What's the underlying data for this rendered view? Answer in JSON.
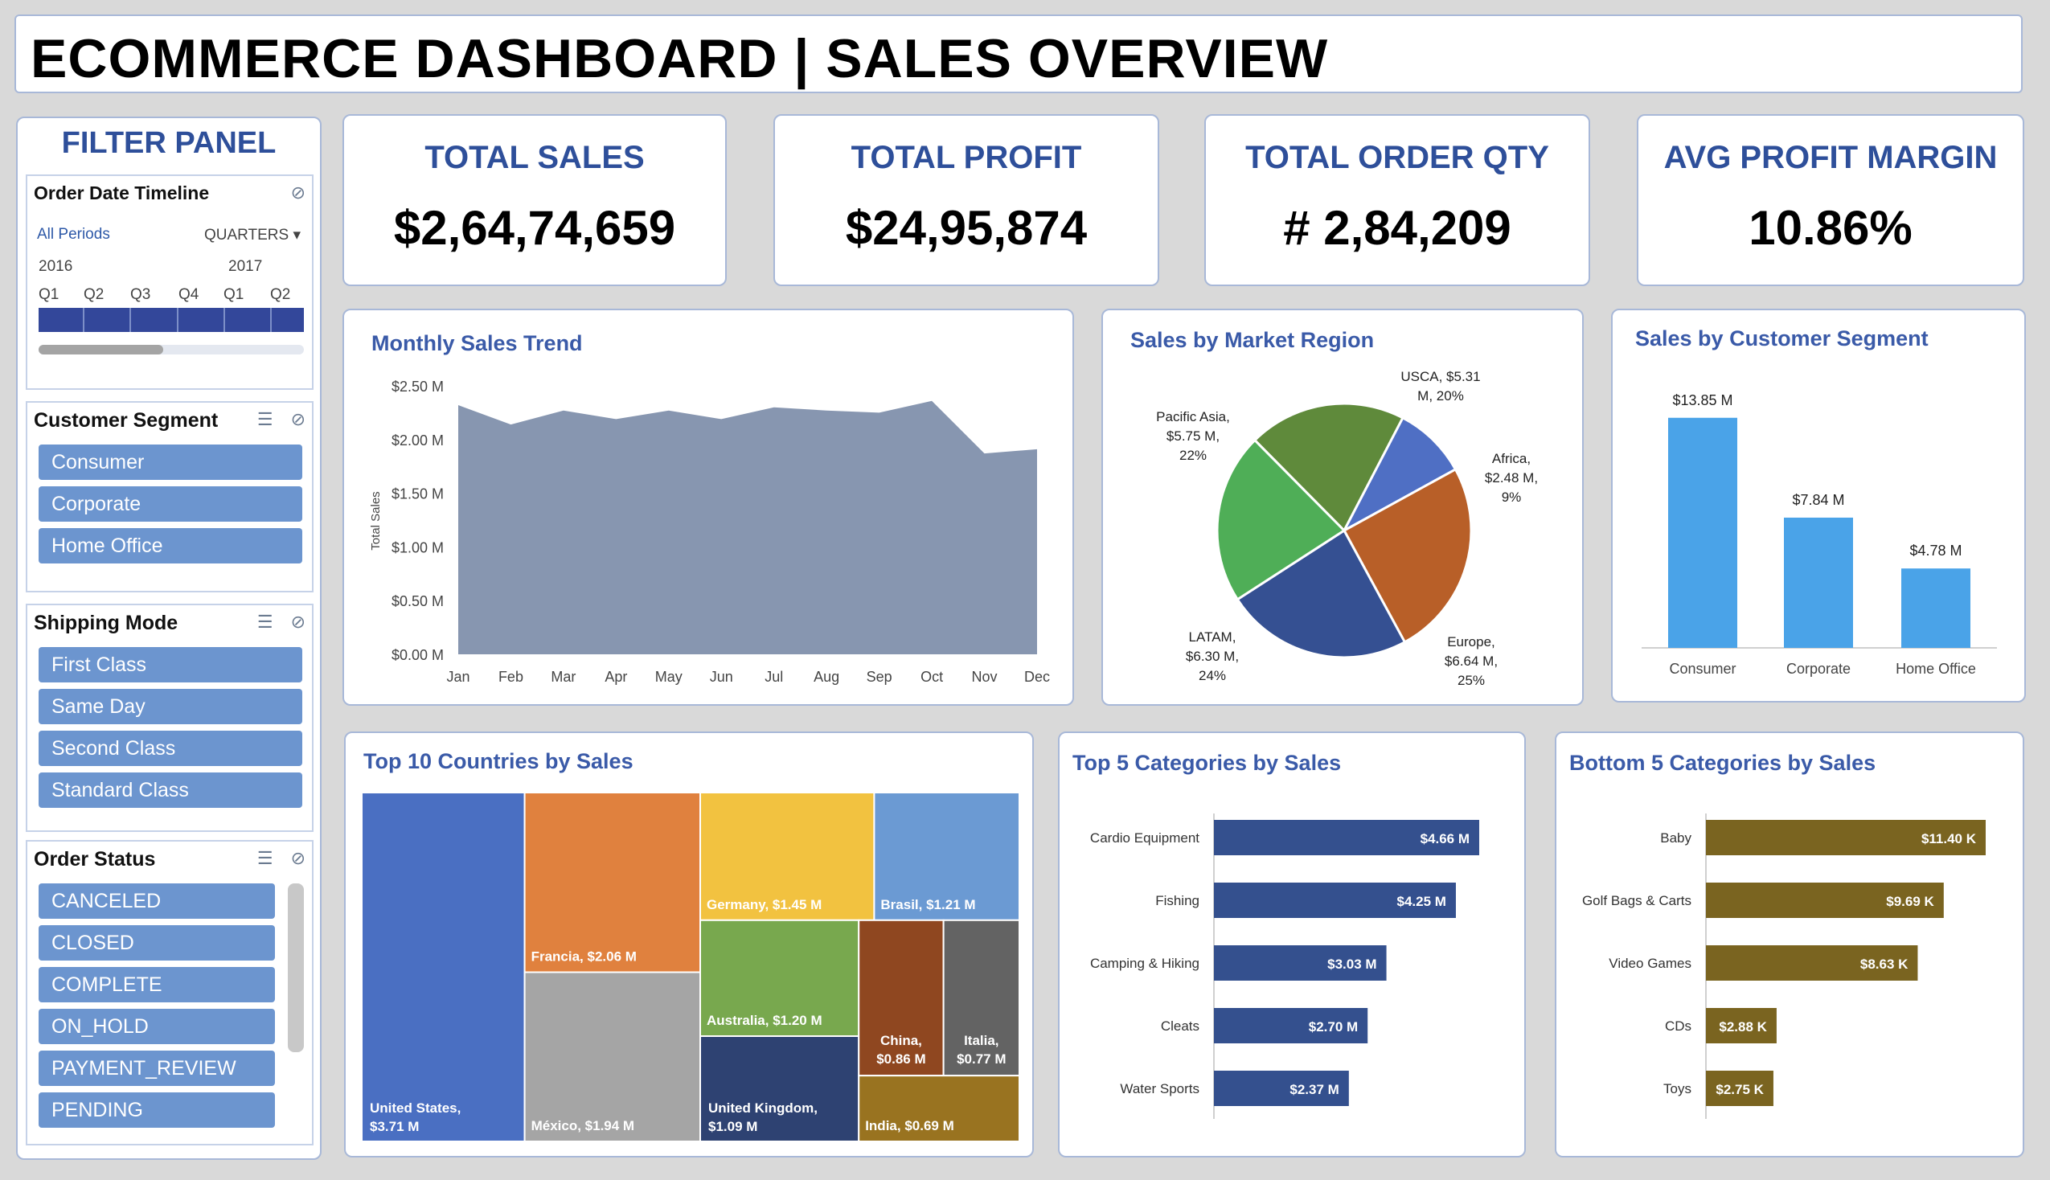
{
  "header": {
    "title": "ECOMMERCE DASHBOARD | SALES OVERVIEW"
  },
  "filter_panel": {
    "title": "FILTER PANEL",
    "timeline": {
      "title": "Order Date Timeline",
      "all_periods": "All Periods",
      "granularity": "QUARTERS",
      "years": [
        "2016",
        "2017"
      ],
      "quarters": [
        "Q1",
        "Q2",
        "Q3",
        "Q4",
        "Q1",
        "Q2"
      ]
    },
    "customer_segment": {
      "title": "Customer Segment",
      "items": [
        "Consumer",
        "Corporate",
        "Home Office"
      ]
    },
    "shipping_mode": {
      "title": "Shipping Mode",
      "items": [
        "First Class",
        "Same Day",
        "Second Class",
        "Standard Class"
      ]
    },
    "order_status": {
      "title": "Order Status",
      "items": [
        "CANCELED",
        "CLOSED",
        "COMPLETE",
        "ON_HOLD",
        "PAYMENT_REVIEW",
        "PENDING"
      ]
    },
    "icons": {
      "multiselect": "multi-select-icon",
      "clear": "clear-filter-icon",
      "dropdown": "chevron-down-icon"
    }
  },
  "kpis": [
    {
      "label": "TOTAL SALES",
      "value": "$2,64,74,659"
    },
    {
      "label": "TOTAL PROFIT",
      "value": "$24,95,874"
    },
    {
      "label": "TOTAL ORDER QTY",
      "value": "# 2,84,209"
    },
    {
      "label": "AVG PROFIT MARGIN",
      "value": "10.86%"
    }
  ],
  "colors": {
    "accent": "#2e4f9a",
    "area": "#8796b0",
    "slicer": "#6c95cf",
    "segment_bar": "#4aa3e8",
    "top5_bar": "#34508e",
    "bottom5_bar": "#7a6420"
  },
  "chart_data": [
    {
      "type": "area",
      "title": "Monthly Sales Trend",
      "ylabel": "Total Sales",
      "x": [
        "Jan",
        "Feb",
        "Mar",
        "Apr",
        "May",
        "Jun",
        "Jul",
        "Aug",
        "Sep",
        "Oct",
        "Nov",
        "Dec"
      ],
      "values": [
        2.32,
        2.14,
        2.27,
        2.19,
        2.27,
        2.19,
        2.3,
        2.27,
        2.25,
        2.36,
        1.87,
        1.91
      ],
      "unit": "$M",
      "ylim": [
        0,
        2.5
      ],
      "yticks": [
        "$0.00 M",
        "$0.50 M",
        "$1.00 M",
        "$1.50 M",
        "$2.00 M",
        "$2.50 M"
      ],
      "grid": false
    },
    {
      "type": "pie",
      "title": "Sales by Market Region",
      "slices": [
        {
          "name": "USCA",
          "value": 5.31,
          "label": [
            "USCA, $5.31",
            "M, 20%"
          ],
          "color": "#5f8a3b"
        },
        {
          "name": "Africa",
          "value": 2.48,
          "label": [
            "Africa,",
            "$2.48 M,",
            "9%"
          ],
          "color": "#4f6fc4"
        },
        {
          "name": "Europe",
          "value": 6.64,
          "label": [
            "Europe,",
            "$6.64 M,",
            "25%"
          ],
          "color": "#b85f28"
        },
        {
          "name": "LATAM",
          "value": 6.3,
          "label": [
            "LATAM,",
            "$6.30 M,",
            "24%"
          ],
          "color": "#355092"
        },
        {
          "name": "Pacific Asia",
          "value": 5.75,
          "label": [
            "Pacific Asia,",
            "$5.75 M,",
            "22%"
          ],
          "color": "#4fae57"
        }
      ]
    },
    {
      "type": "bar",
      "title": "Sales by Customer Segment",
      "categories": [
        "Consumer",
        "Corporate",
        "Home Office"
      ],
      "values": [
        13.85,
        7.84,
        4.78
      ],
      "labels": [
        "$13.85 M",
        "$7.84 M",
        "$4.78 M"
      ],
      "ylim": [
        0,
        15
      ]
    },
    {
      "type": "heatmap",
      "title": "Top 10 Countries by Sales",
      "items": [
        {
          "label": "United States, $3.71 M",
          "value": 3.71,
          "color": "#4a6fc2"
        },
        {
          "label": "Francia, $2.06 M",
          "value": 2.06,
          "color": "#e0813e"
        },
        {
          "label": "México, $1.94 M",
          "value": 1.94,
          "color": "#a5a5a5"
        },
        {
          "label": "Germany, $1.45 M",
          "value": 1.45,
          "color": "#f2c240"
        },
        {
          "label": "Brasil, $1.21 M",
          "value": 1.21,
          "color": "#6b9ad3"
        },
        {
          "label": "Australia, $1.20 M",
          "value": 1.2,
          "color": "#78a84e"
        },
        {
          "label": "United Kingdom, $1.09 M",
          "value": 1.09,
          "color": "#2e4272"
        },
        {
          "label": "China, $0.86 M",
          "value": 0.86,
          "color": "#8f4720"
        },
        {
          "label": "Italia, $0.77 M",
          "value": 0.77,
          "color": "#636363"
        },
        {
          "label": "India, $0.69 M",
          "value": 0.69,
          "color": "#997320"
        }
      ]
    },
    {
      "type": "bar",
      "orientation": "horizontal",
      "title": "Top 5 Categories by Sales",
      "categories": [
        "Cardio Equipment",
        "Fishing",
        "Camping & Hiking",
        "Cleats",
        "Water Sports"
      ],
      "values": [
        4.66,
        4.25,
        3.03,
        2.7,
        2.37
      ],
      "labels": [
        "$4.66 M",
        "$4.25 M",
        "$3.03 M",
        "$2.70 M",
        "$2.37 M"
      ],
      "xlim": [
        0,
        5.5
      ]
    },
    {
      "type": "bar",
      "orientation": "horizontal",
      "title": "Bottom 5 Categories by Sales",
      "categories": [
        "Baby",
        "Golf Bags & Carts",
        "Video Games",
        "CDs",
        "Toys"
      ],
      "values": [
        11.4,
        9.69,
        8.63,
        2.88,
        2.75
      ],
      "labels": [
        "$11.40 K",
        "$9.69 K",
        "$8.63 K",
        "$2.88 K",
        "$2.75 K"
      ],
      "xlim": [
        0,
        14
      ]
    }
  ]
}
